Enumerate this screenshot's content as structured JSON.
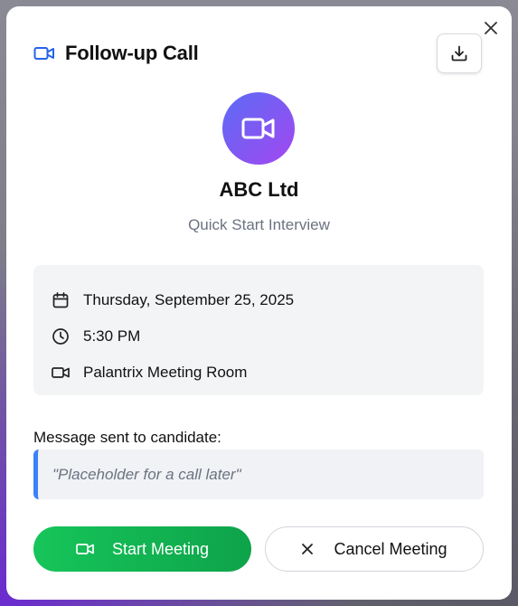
{
  "dialog": {
    "title": "Follow-up Call",
    "title_icon": "video-icon",
    "close_icon": "close-icon",
    "download_icon": "download-icon"
  },
  "profile": {
    "avatar_icon": "video-icon",
    "company": "ABC Ltd",
    "subtitle": "Quick Start Interview"
  },
  "details": {
    "date": "Thursday, September 25, 2025",
    "time": "5:30 PM",
    "location": "Palantrix Meeting Room"
  },
  "message": {
    "label": "Message sent to candidate:",
    "text": "\"Placeholder for a call later\""
  },
  "actions": {
    "start_label": "Start Meeting",
    "cancel_label": "Cancel Meeting"
  },
  "colors": {
    "accent_blue": "#3b82f6",
    "start_green": "#16c55a",
    "avatar_gradient_start": "#5b6cf5",
    "avatar_gradient_end": "#a347f0"
  }
}
